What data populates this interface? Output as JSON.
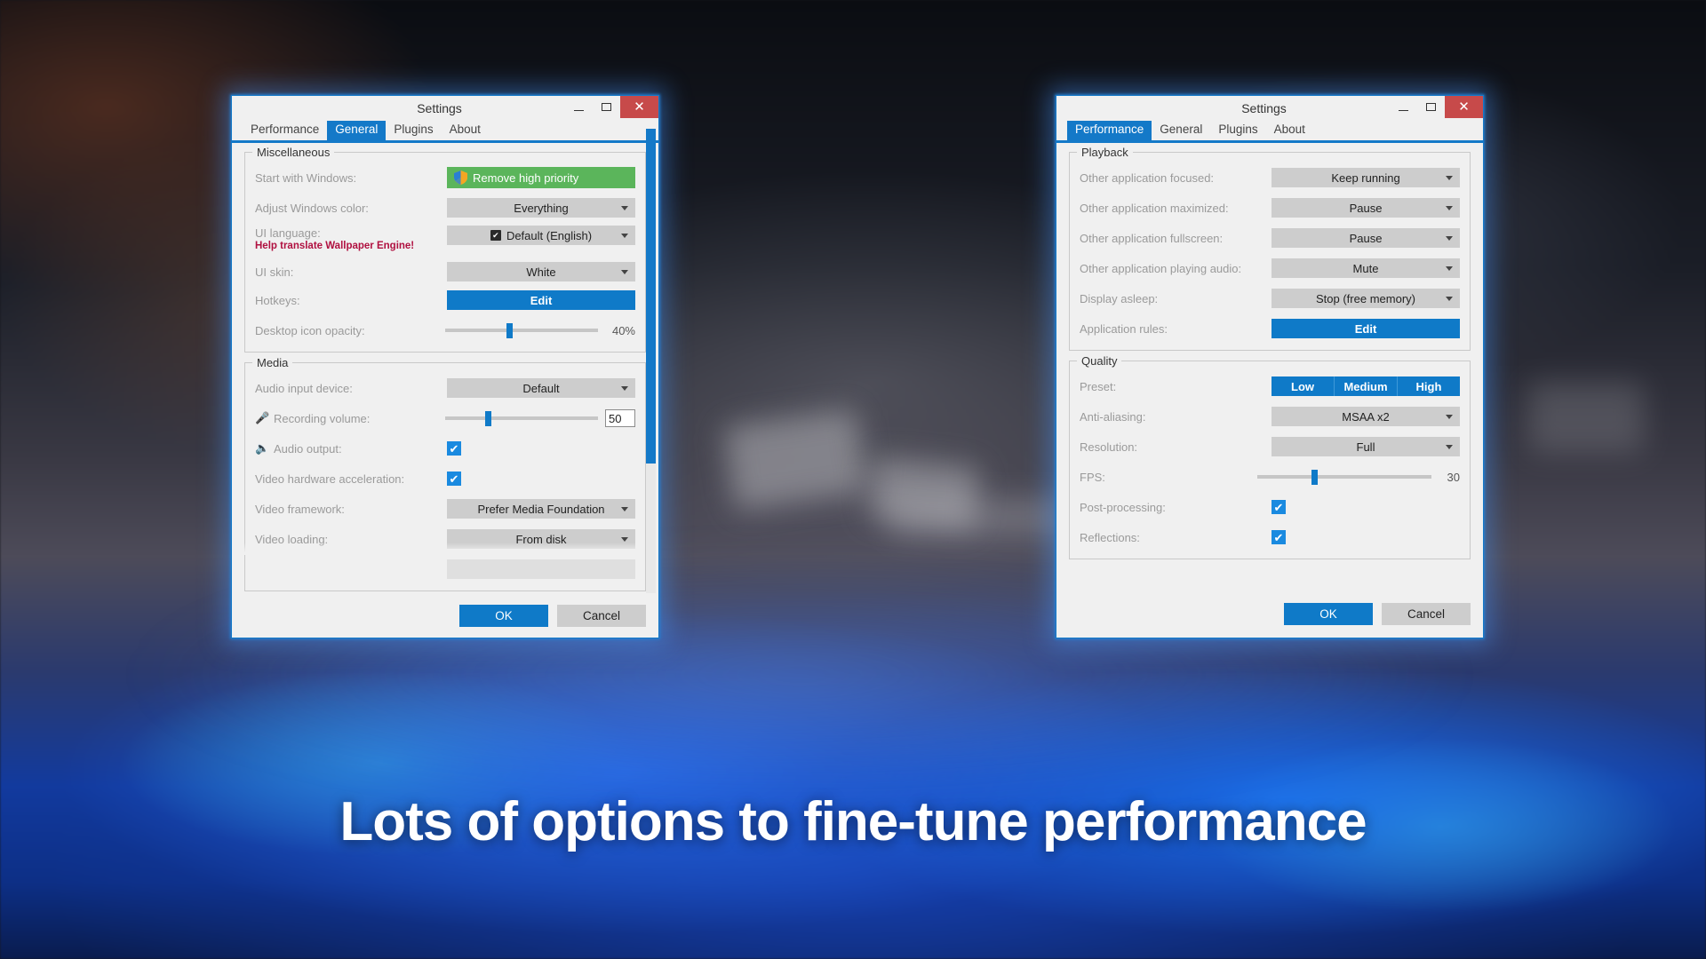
{
  "caption": "Lots of options to fine-tune performance",
  "window_controls": {
    "minimize": "–",
    "maximize": "□",
    "close": "✕"
  },
  "left_dialog": {
    "title": "Settings",
    "tabs": [
      {
        "label": "Performance",
        "active": false
      },
      {
        "label": "General",
        "active": true
      },
      {
        "label": "Plugins",
        "active": false
      },
      {
        "label": "About",
        "active": false
      }
    ],
    "groups": [
      {
        "title": "Miscellaneous",
        "rows": [
          {
            "label": "Start with Windows:",
            "control": "button-green",
            "value": "Remove high priority",
            "icon": "shield-icon"
          },
          {
            "label": "Adjust Windows color:",
            "control": "combo",
            "value": "Everything"
          },
          {
            "label": "UI language:",
            "sublabel": "Help translate Wallpaper Engine!",
            "control": "combo",
            "value": "Default (English)",
            "icon": "steam-icon"
          },
          {
            "label": "UI skin:",
            "control": "combo",
            "value": "White"
          },
          {
            "label": "Hotkeys:",
            "control": "button-blue",
            "value": "Edit"
          },
          {
            "label": "Desktop icon opacity:",
            "control": "slider",
            "value": "40%",
            "percent": 40
          }
        ]
      },
      {
        "title": "Media",
        "rows": [
          {
            "label": "Audio input device:",
            "control": "combo",
            "value": "Default"
          },
          {
            "label": "Recording volume:",
            "control": "slider-input",
            "value": "50",
            "percent": 26,
            "icon": "microphone-icon"
          },
          {
            "label": "Audio output:",
            "control": "checkbox",
            "value": "✔",
            "checked": true,
            "icon": "speaker-icon"
          },
          {
            "label": "Video hardware acceleration:",
            "control": "checkbox",
            "value": "✔",
            "checked": true
          },
          {
            "label": "Video framework:",
            "control": "combo",
            "value": "Prefer Media Foundation"
          },
          {
            "label": "Video loading:",
            "control": "combo",
            "value": "From disk"
          }
        ]
      }
    ],
    "footer": {
      "ok": "OK",
      "cancel": "Cancel"
    }
  },
  "right_dialog": {
    "title": "Settings",
    "tabs": [
      {
        "label": "Performance",
        "active": true
      },
      {
        "label": "General",
        "active": false
      },
      {
        "label": "Plugins",
        "active": false
      },
      {
        "label": "About",
        "active": false
      }
    ],
    "groups": [
      {
        "title": "Playback",
        "rows": [
          {
            "label": "Other application focused:",
            "control": "combo",
            "value": "Keep running"
          },
          {
            "label": "Other application maximized:",
            "control": "combo",
            "value": "Pause"
          },
          {
            "label": "Other application fullscreen:",
            "control": "combo",
            "value": "Pause"
          },
          {
            "label": "Other application playing audio:",
            "control": "combo",
            "value": "Mute"
          },
          {
            "label": "Display asleep:",
            "control": "combo",
            "value": "Stop (free memory)"
          },
          {
            "label": "Application rules:",
            "control": "button-blue",
            "value": "Edit"
          }
        ]
      },
      {
        "title": "Quality",
        "rows": [
          {
            "label": "Preset:",
            "control": "segmented",
            "options": [
              "Low",
              "Medium",
              "High"
            ]
          },
          {
            "label": "Anti-aliasing:",
            "control": "combo",
            "value": "MSAA x2"
          },
          {
            "label": "Resolution:",
            "control": "combo",
            "value": "Full"
          },
          {
            "label": "FPS:",
            "control": "slider-value",
            "value": "30",
            "percent": 31
          },
          {
            "label": "Post-processing:",
            "control": "checkbox",
            "value": "✔",
            "checked": true
          },
          {
            "label": "Reflections:",
            "control": "checkbox",
            "value": "✔",
            "checked": true
          }
        ]
      }
    ],
    "footer": {
      "ok": "OK",
      "cancel": "Cancel"
    }
  },
  "colors": {
    "accent": "#1479c8",
    "button_blue": "#0f7ac8",
    "button_green": "#5bb55b",
    "close_red": "#c74a4a",
    "link_red": "#b01040",
    "combo_gray": "#cdcdcd",
    "dialog_bg": "#f0f0f0"
  }
}
